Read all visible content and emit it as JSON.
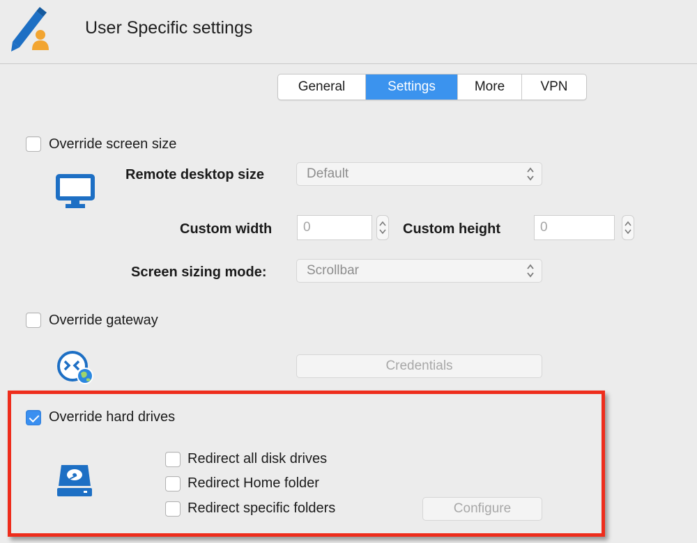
{
  "window": {
    "title": "User Specific settings",
    "icon": "pencil-user-icon"
  },
  "tabs": [
    {
      "label": "General",
      "active": false
    },
    {
      "label": "Settings",
      "active": true
    },
    {
      "label": "More",
      "active": false
    },
    {
      "label": "VPN",
      "active": false
    }
  ],
  "screen": {
    "override_label": "Override screen size",
    "override_checked": false,
    "icon": "monitor-icon",
    "remote_desktop_size_label": "Remote desktop size",
    "remote_desktop_size_value": "Default",
    "custom_width_label": "Custom width",
    "custom_width_value": "0",
    "custom_height_label": "Custom height",
    "custom_height_value": "0",
    "sizing_mode_label": "Screen sizing mode:",
    "sizing_mode_value": "Scrollbar"
  },
  "gateway": {
    "override_label": "Override gateway",
    "override_checked": false,
    "icon": "gateway-globe-icon",
    "credentials_label": "Credentials"
  },
  "drives": {
    "override_label": "Override hard drives",
    "override_checked": true,
    "icon": "hard-drive-icon",
    "options": [
      {
        "label": "Redirect all disk drives",
        "checked": false
      },
      {
        "label": "Redirect Home folder",
        "checked": false
      },
      {
        "label": "Redirect specific folders",
        "checked": false
      }
    ],
    "configure_label": "Configure"
  },
  "colors": {
    "accent": "#3b93ee",
    "icon_blue": "#1d6fc4",
    "highlight": "#ee2d1c"
  }
}
